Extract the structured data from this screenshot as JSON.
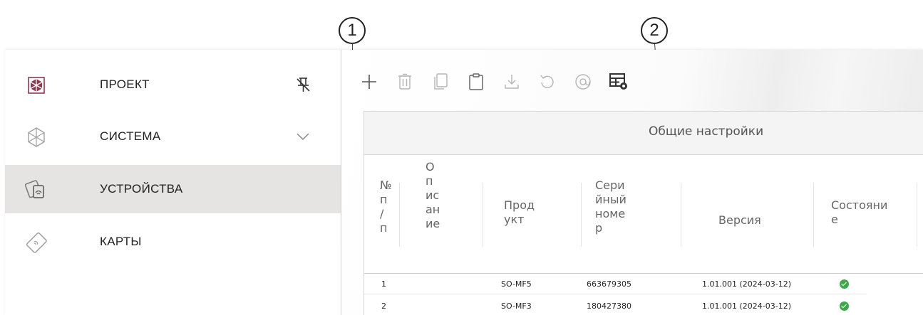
{
  "callouts": {
    "one": "1",
    "two": "2"
  },
  "sidebar": {
    "items": [
      {
        "label": "ПРОЕКТ",
        "icon": "project-icon",
        "right_icon": "unpin-icon",
        "active": false
      },
      {
        "label": "СИСТЕМА",
        "icon": "system-icon",
        "right_icon": "chevron-down-icon",
        "active": false
      },
      {
        "label": "УСТРОЙСТВА",
        "icon": "devices-icon",
        "right_icon": "",
        "active": true
      },
      {
        "label": "КАРТЫ",
        "icon": "cards-icon",
        "right_icon": "",
        "active": false
      }
    ]
  },
  "toolbar": {
    "buttons": [
      "add-icon",
      "delete-icon",
      "copy-icon",
      "paste-icon",
      "download-icon",
      "undo-icon",
      "at-icon",
      "table-settings-icon"
    ]
  },
  "table": {
    "group_header": "Общие настройки",
    "columns": {
      "number": [
        "№",
        "п",
        "/",
        "п"
      ],
      "description": [
        "О",
        "п",
        "ис",
        "ан",
        "ие"
      ],
      "product": [
        "Прод",
        "укт"
      ],
      "serial": [
        "Сери",
        "йный",
        "номе",
        "р"
      ],
      "version": [
        "Версия"
      ],
      "status": [
        "Состояни",
        "е"
      ]
    },
    "rows": [
      {
        "number": "1",
        "description": "",
        "product": "SO-MF5",
        "serial": "663679305",
        "version": "1.01.001 (2024-03-12)",
        "status": "ok"
      },
      {
        "number": "2",
        "description": "",
        "product": "SO-MF3",
        "serial": "180427380",
        "version": "1.01.001 (2024-03-12)",
        "status": "ok"
      }
    ]
  },
  "colors": {
    "active_bg": "#e6e4e3",
    "status_ok": "#3da74a",
    "icon_gray": "#a0a0a0",
    "icon_accent": "#8a3a52"
  }
}
